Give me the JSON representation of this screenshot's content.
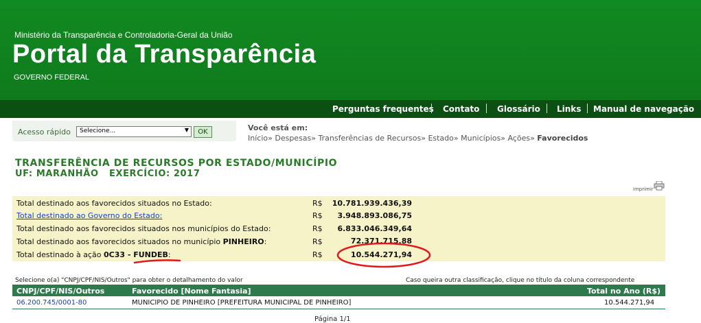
{
  "header": {
    "ministry": "Ministério da Transparência e Controladoria-Geral da União",
    "title": "Portal da Transparência",
    "gov": "GOVERNO FEDERAL",
    "accent": "#117a1f"
  },
  "nav": {
    "items": [
      "Perguntas frequentes",
      "Contato",
      "Glossário",
      "Links",
      "Manual de navegação"
    ]
  },
  "quick_access": {
    "label": "Acesso rápido",
    "select_value": "Selecione...",
    "ok_label": "OK"
  },
  "breadcrumb": {
    "title": "Você está em:",
    "path": [
      "Início",
      "Despesas",
      "Transferências de Recursos",
      "Estado",
      "Municípios",
      "Ações"
    ],
    "current": "Favorecidos",
    "separator": "»"
  },
  "section": {
    "title": "TRANSFERÊNCIA DE RECURSOS POR ESTADO/MUNICÍPIO",
    "subtitle": "UF: MARANHÃO   EXERCÍCIO: 2017"
  },
  "print_label": "imprimir",
  "summary": {
    "rows": [
      {
        "label": "Total destinado aos favorecidos situados no Estado:",
        "currency": "R$",
        "value": "10.781.939.436,39"
      },
      {
        "label": "Total destinado ao Governo do Estado:",
        "currency": "R$",
        "value": "3.948.893.086,75"
      },
      {
        "label": "Total destinado aos favorecidos situados nos municípios do Estado:",
        "currency": "R$",
        "value": "6.833.046.349,64"
      },
      {
        "label": "Total destinado aos favorecidos situados no município",
        "label_bold": "PINHEIRO",
        "label_end": ":",
        "currency": "R$",
        "value": "72.371.715,88"
      },
      {
        "label": "Total destinado à ação",
        "label_bold": "0C33 - FUNDEB",
        "label_end": ":",
        "currency": "R$",
        "value": "10.544.271,94"
      }
    ]
  },
  "notes": {
    "left": "Selecione o(a) \"CNPJ/CPF/NIS/Outros\" para obter o detalhamento do valor",
    "right": "Caso queira outra classificação, clique no título da coluna correspondente"
  },
  "table": {
    "headers": [
      "CNPJ/CPF/NIS/Outros",
      "Favorecido [Nome Fantasia]",
      "Total no Ano (R$)"
    ],
    "rows": [
      {
        "id": "06.200.745/0001-80",
        "name": "MUNICIPIO DE PINHEIRO [PREFEITURA MUNICIPAL DE PINHEIRO]",
        "total": "10.544.271,94"
      }
    ]
  },
  "pager": "Página 1/1",
  "annotation_color": "#e0191e"
}
